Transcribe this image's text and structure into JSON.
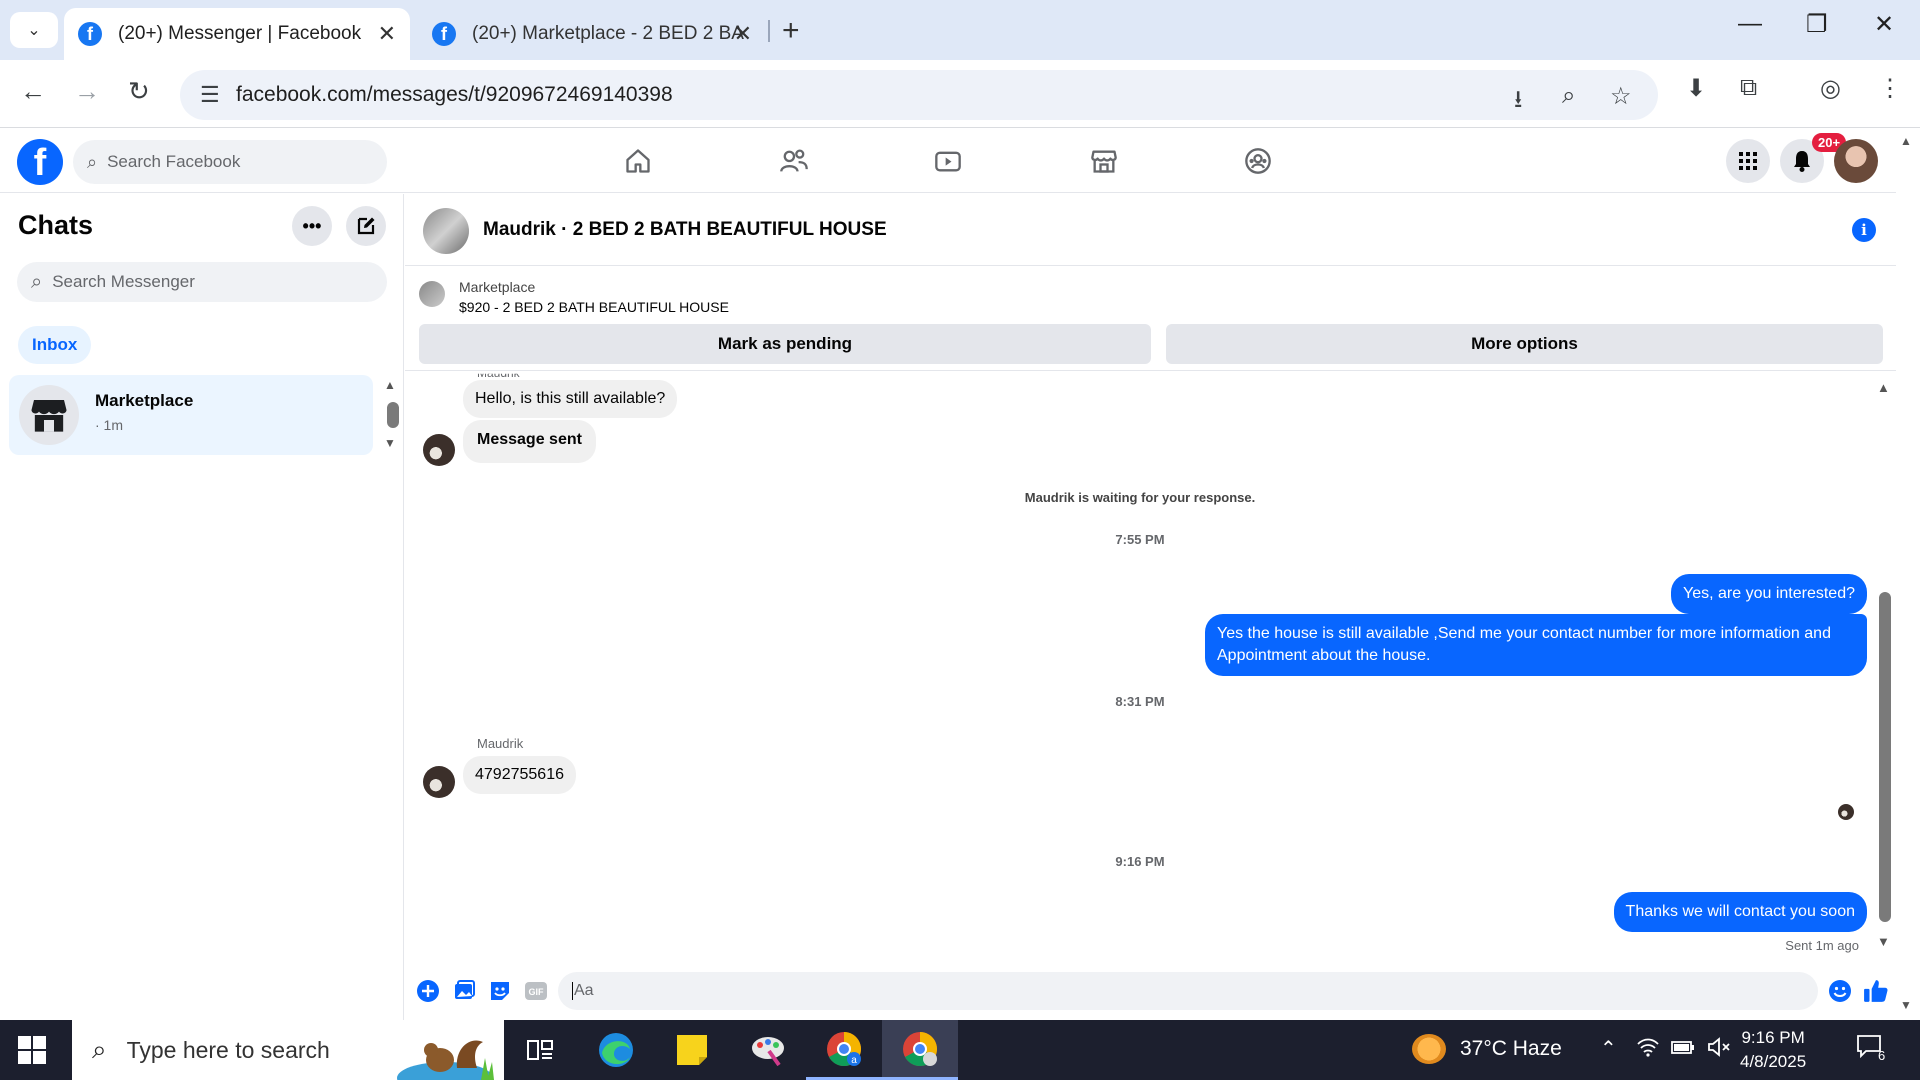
{
  "browser": {
    "tabs": [
      {
        "title": "(20+) Messenger | Facebook",
        "active": true
      },
      {
        "title": "(20+) Marketplace - 2 BED 2 BA",
        "active": false
      }
    ],
    "url": "facebook.com/messages/t/9209672469140398"
  },
  "fb": {
    "search_placeholder": "Search Facebook",
    "notifications_badge": "20+"
  },
  "left": {
    "title": "Chats",
    "search_placeholder": "Search Messenger",
    "filter": "Inbox",
    "conversations": [
      {
        "name": "Marketplace",
        "time": "· 1m"
      }
    ]
  },
  "chat": {
    "title": "Maudrik · 2 BED 2 BATH BEAUTIFUL HOUSE",
    "listing_source": "Marketplace",
    "listing_text": "$920 - 2 BED 2 BATH BEAUTIFUL HOUSE",
    "btn_pending": "Mark as pending",
    "btn_more": "More options",
    "sender_cut": "Maudrik",
    "msg_in_1": "Hello, is this still available?",
    "msg_in_2": "Message sent",
    "waiting_note": "Maudrik is waiting for your response.",
    "time_1": "7:55 PM",
    "msg_out_1": "Yes, are you interested?",
    "msg_out_2": "Yes the house is still available ,Send me your contact number for more information and Appointment about the house.",
    "time_2": "8:31 PM",
    "sender_name": "Maudrik",
    "msg_in_3": "4792755616",
    "time_3": "9:16 PM",
    "msg_out_3": "Thanks we will contact you soon",
    "sent_meta": "Sent 1m ago",
    "composer_placeholder": "Aa"
  },
  "taskbar": {
    "search_placeholder": "Type here to search",
    "weather": "37°C  Haze",
    "time": "9:16 PM",
    "date": "4/8/2025",
    "notif_count": "6"
  },
  "colors": {
    "accent": "#0866ff",
    "outgoing_bubble": "#0866ff",
    "incoming_bubble": "#f0f0f0",
    "badge": "#e41e3f"
  }
}
